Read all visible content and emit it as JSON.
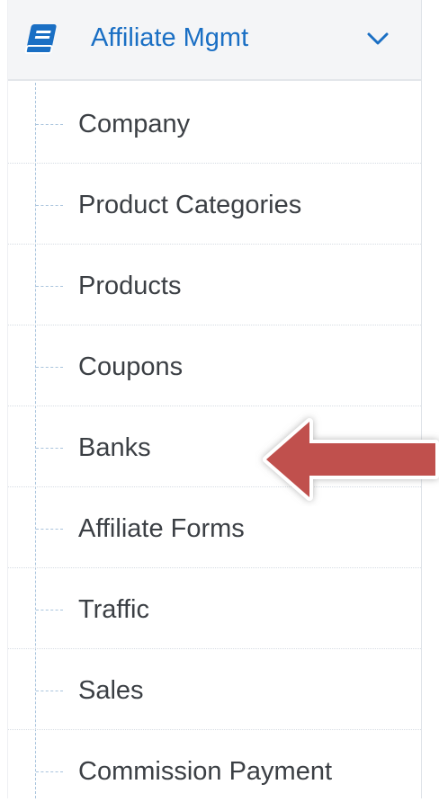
{
  "menu": {
    "header": {
      "label": "Affiliate Mgmt",
      "icon": "book-icon",
      "toggle_icon": "chevron-down-icon",
      "expanded": true
    },
    "items": [
      {
        "label": "Company",
        "name": "submenu-item-company"
      },
      {
        "label": "Product Categories",
        "name": "submenu-item-product-categories"
      },
      {
        "label": "Products",
        "name": "submenu-item-products"
      },
      {
        "label": "Coupons",
        "name": "submenu-item-coupons"
      },
      {
        "label": "Banks",
        "name": "submenu-item-banks"
      },
      {
        "label": "Affiliate Forms",
        "name": "submenu-item-affiliate-forms"
      },
      {
        "label": "Traffic",
        "name": "submenu-item-traffic"
      },
      {
        "label": "Sales",
        "name": "submenu-item-sales"
      },
      {
        "label": "Commission Payment",
        "name": "submenu-item-commission-payment"
      }
    ]
  },
  "annotation": {
    "type": "arrow",
    "points_to": "Banks",
    "color": "#c0504d"
  },
  "colors": {
    "accent": "#1a6fc4",
    "header_bg": "#f4f5f7",
    "item_text": "#3b3f44",
    "tree_line": "#a9c4dd"
  }
}
